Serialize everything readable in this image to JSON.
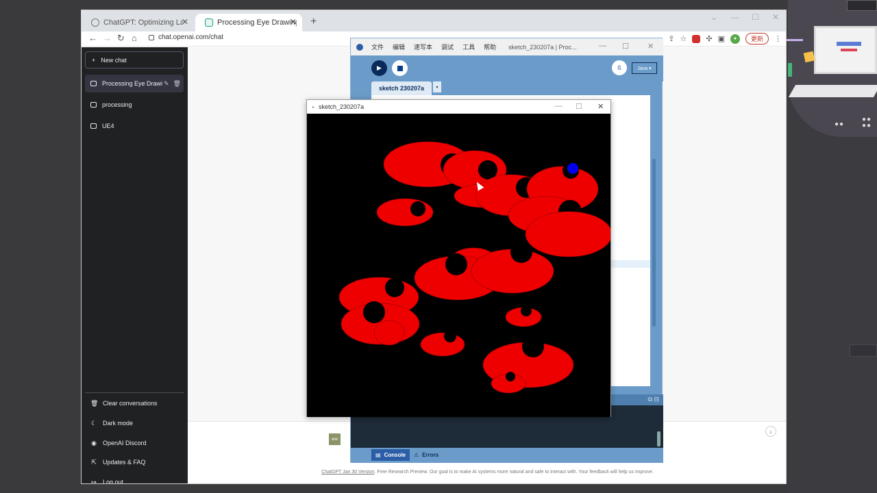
{
  "browser": {
    "tabs": [
      {
        "title": "ChatGPT: Optimizing Languag"
      },
      {
        "title": "Processing Eye Drawing"
      }
    ],
    "url": "chat.openai.com/chat",
    "update_label": "更新"
  },
  "chatgpt": {
    "new_chat": "New chat",
    "conversations": [
      "Processing Eye Drawi",
      "processing",
      "UE4"
    ],
    "bottom_menu": [
      "Clear conversations",
      "Dark mode",
      "OpenAI Discord",
      "Updates & FAQ",
      "Log out"
    ],
    "avatar_text": "ww",
    "footer_version": "ChatGPT Jan 30 Version",
    "footer_text": ". Free Research Preview. Our goal is to make AI systems more natural and safe to interact with. Your feedback will help us improve."
  },
  "pde": {
    "menus": [
      "文件",
      "编辑",
      "速写本",
      "调试",
      "工具",
      "帮助"
    ],
    "title": "sketch_230207a | Proc...",
    "mode": "Java ▾",
    "sketch_tab": "sketch 230207a",
    "console_tab": "Console",
    "errors_tab": "Errors"
  },
  "sketch_window": {
    "title": "sketch_230207a"
  },
  "colors": {
    "eye_red": "#ee0000",
    "pupil": "#000000",
    "highlight_pupil": "#0000ee"
  }
}
